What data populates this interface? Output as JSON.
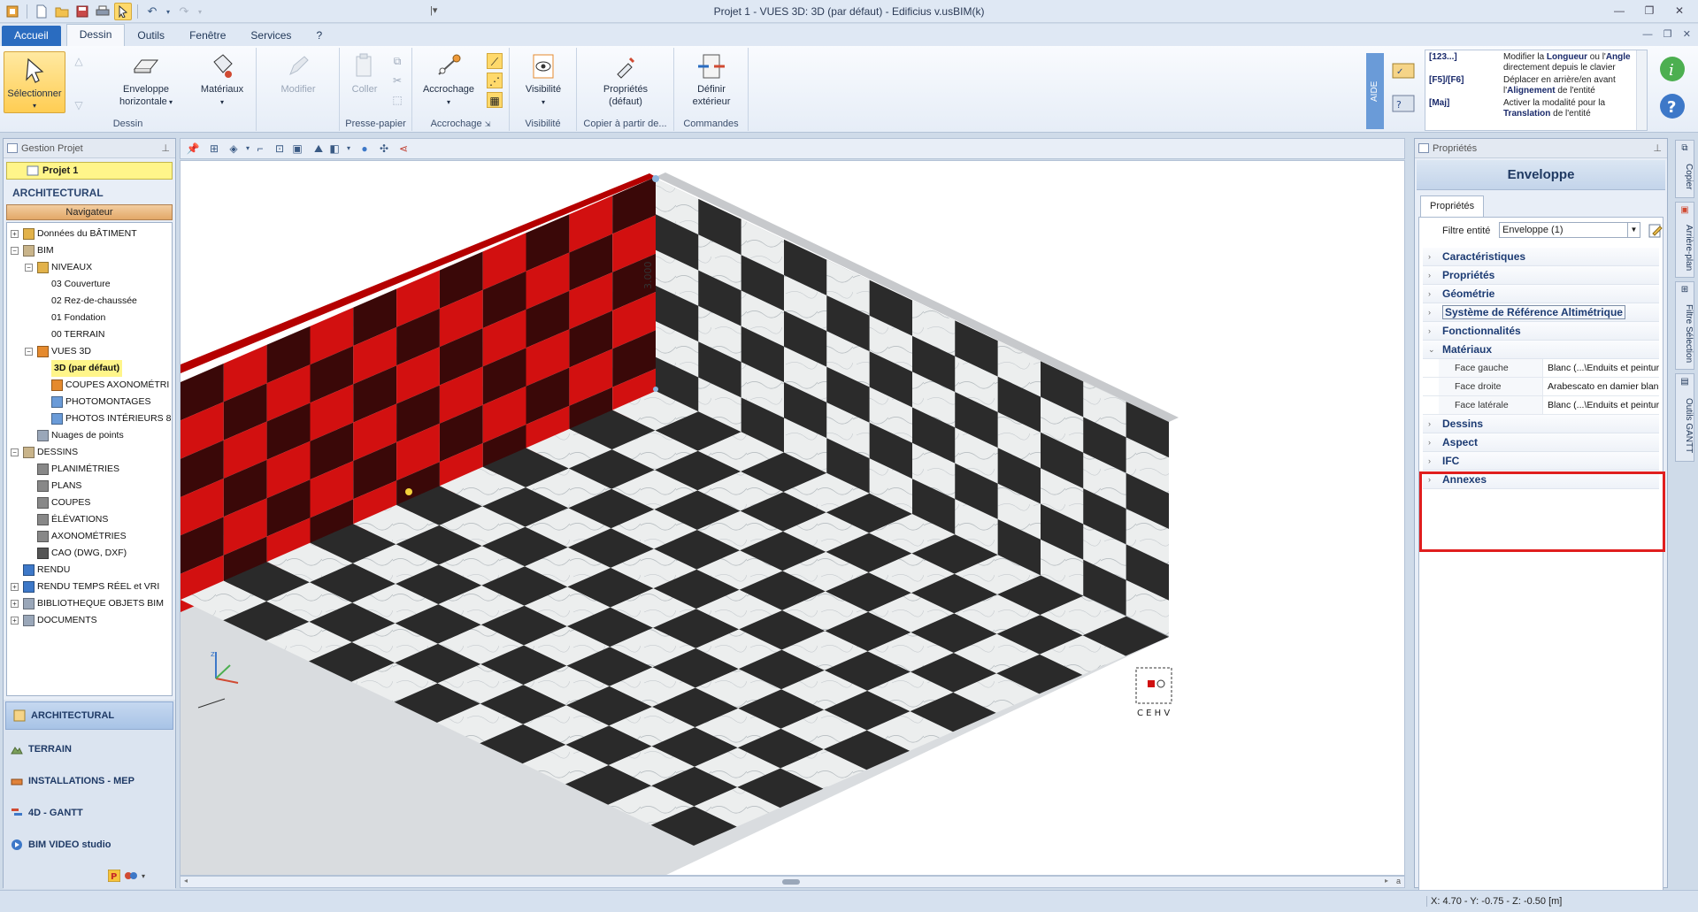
{
  "window": {
    "title": "Projet 1 -  VUES 3D: 3D (par défaut) - Edificius v.usBIM(k)"
  },
  "tabs": [
    "Accueil",
    "Dessin",
    "Outils",
    "Fenêtre",
    "Services",
    "?"
  ],
  "ribbon": {
    "select": "Sélectionner",
    "envelope_1": "Enveloppe",
    "envelope_2": "horizontale",
    "materials": "Matériaux",
    "modify": "Modifier",
    "paste": "Coller",
    "snap": "Accrochage",
    "visibility": "Visibilité",
    "props_1": "Propriétés",
    "props_2": "(défaut)",
    "exterior_1": "Définir",
    "exterior_2": "extérieur",
    "groups": {
      "dessin": "Dessin",
      "clipboard": "Presse-papier",
      "snap": "Accrochage",
      "visibility": "Visibilité",
      "copy_from": "Copier à partir de...",
      "commands": "Commandes"
    }
  },
  "help": {
    "strip": "AIDE",
    "rows": [
      {
        "key": "[123...]",
        "pre": "Modifier la ",
        "b1": "Longueur",
        "mid": " ou l'",
        "b2": "Angle",
        "post": " directement depuis le clavier"
      },
      {
        "key": "[F5]/[F6]",
        "pre": "Déplacer en arrière/en avant l'",
        "b1": "",
        "mid": "",
        "b2": "Alignement",
        "post": " de l'entité"
      },
      {
        "key": "[Maj]",
        "pre": "Activer la modalité pour la ",
        "b1": "",
        "mid": "",
        "b2": "Translation",
        "post": " de l'entité"
      }
    ]
  },
  "left": {
    "panel_title": "Gestion Projet",
    "project": "Projet 1",
    "section": "ARCHITECTURAL",
    "navigator": "Navigateur",
    "tree": [
      "Données du BÂTIMENT",
      "BIM",
      "NIVEAUX",
      "03 Couverture",
      "02 Rez-de-chaussée",
      "01 Fondation",
      "00 TERRAIN",
      "VUES 3D",
      "3D (par défaut)",
      "COUPES AXONOMÉTRI",
      "PHOTOMONTAGES",
      "PHOTOS INTÉRIEURS 8",
      "Nuages de points",
      "DESSINS",
      "PLANIMÉTRIES",
      "PLANS",
      "COUPES",
      "ÉLÉVATIONS",
      "AXONOMÉTRIES",
      "CAO (DWG, DXF)",
      "RENDU",
      "RENDU TEMPS RÉEL et VRI",
      "BIBLIOTHEQUE OBJETS BIM",
      "DOCUMENTS"
    ],
    "modules": [
      "ARCHITECTURAL",
      "TERRAIN",
      "INSTALLATIONS - MEP",
      "4D - GANTT",
      "BIM VIDEO studio"
    ]
  },
  "viewport": {
    "dimension_label": "3.000",
    "nav_cube_labels": "C E H V",
    "scroll_label": "a"
  },
  "properties": {
    "panel_title": "Propriétés",
    "header": "Enveloppe",
    "tab": "Propriétés",
    "filter_label": "Filtre entité",
    "filter_value": "Enveloppe (1)",
    "categories_top": [
      "Caractéristiques",
      "Propriétés",
      "Géométrie",
      "Système de Référence Altimétrique",
      "Fonctionnalités",
      "Matériaux"
    ],
    "materials": [
      {
        "key": "Face gauche",
        "value": "Blanc    (...\\Enduits et peinture"
      },
      {
        "key": "Face droite",
        "value": "Arabescato en damier blanc"
      },
      {
        "key": "Face latérale",
        "value": "Blanc    (...\\Enduits et peinture"
      }
    ],
    "categories_bottom": [
      "Dessins",
      "Aspect",
      "IFC",
      "Annexes"
    ]
  },
  "side_tabs": [
    "Copier",
    "Arrière-plan",
    "Filtre Sélection",
    "Outils GANTT"
  ],
  "status": {
    "coords": "X: 4.70 - Y: -0.75 - Z: -0.50 [m]"
  },
  "colors": {
    "accent": "#2a6cc0",
    "highlight": "#fff58a",
    "red_box": "#e01e1e",
    "wall_red": "#d01010",
    "tile_dark": "#2a2a2a"
  }
}
